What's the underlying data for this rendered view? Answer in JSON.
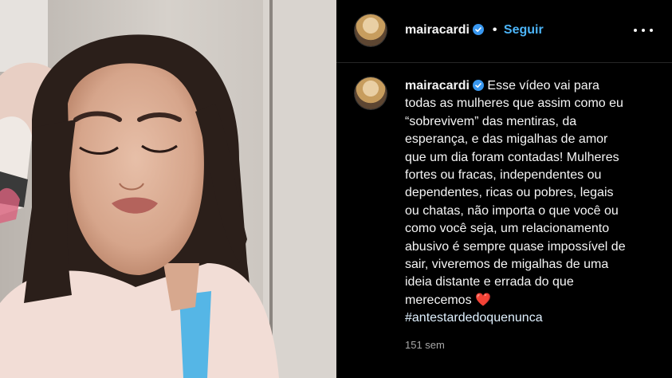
{
  "post": {
    "username": "mairacardi",
    "separator": "•",
    "follow_label": "Seguir",
    "caption_lines": [
      "Esse vídeo vai para",
      "todas as mulheres que assim como eu",
      "“sobrevivem” das mentiras, da",
      "esperança, e das migalhas de amor",
      "que um dia foram contadas! Mulheres",
      "fortes ou fracas, independentes ou",
      "dependentes, ricas ou pobres, legais",
      "ou chatas, não importa o que você ou",
      "como você seja, um relacionamento",
      "abusivo é sempre quase impossível de",
      "sair, viveremos de migalhas de uma",
      "ideia distante e errada do que",
      "merecemos"
    ],
    "heart_emoji": "❤️",
    "hashtag": "#antestardedoquenunca",
    "timestamp": "151 sem"
  },
  "colors": {
    "background": "#000000",
    "follow_blue": "#4cb5f9",
    "verified_blue": "#3897f0",
    "secondary_text": "#a8a8a8"
  },
  "icons": {
    "verified": "verified-badge-icon",
    "more": "more-options-icon",
    "heart": "red-heart-emoji"
  }
}
